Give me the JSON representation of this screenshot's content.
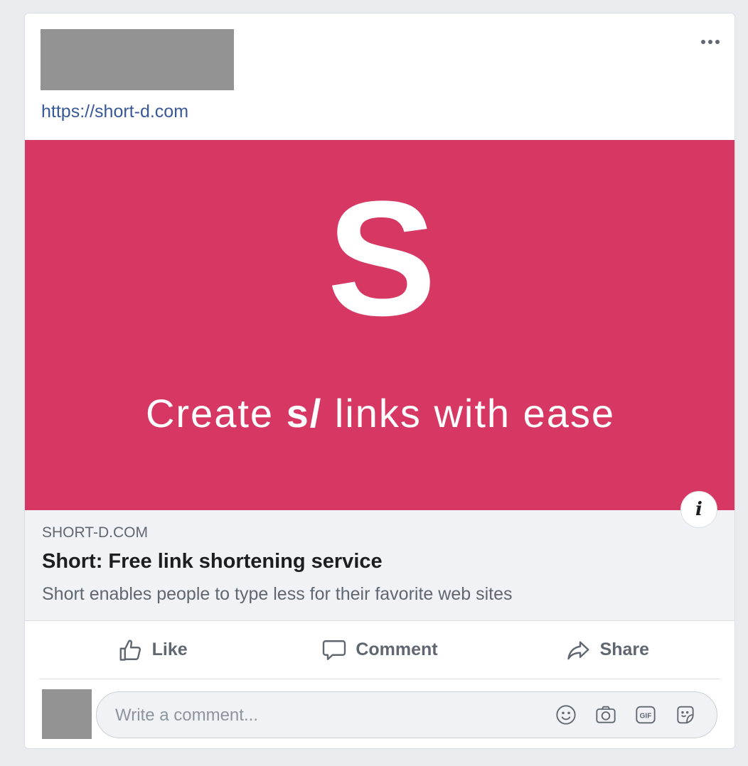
{
  "post": {
    "link_text": "https://short-d.com",
    "hero": {
      "letter": "S",
      "tagline_before": "Create",
      "tagline_brand": "s/",
      "tagline_after": "links with ease",
      "background": "#d63863"
    },
    "preview": {
      "domain": "SHORT-D.COM",
      "title": "Short: Free link shortening service",
      "description": "Short enables people to type less for their favorite web sites"
    },
    "info_icon": "i"
  },
  "actions": {
    "like_label": "Like",
    "comment_label": "Comment",
    "share_label": "Share"
  },
  "comment": {
    "placeholder": "Write a comment...",
    "icons": [
      "emoji-icon",
      "camera-icon",
      "gif-icon",
      "sticker-icon"
    ]
  },
  "colors": {
    "link": "#385898",
    "secondary_text": "#606770",
    "page_bg": "#e9ebee"
  }
}
